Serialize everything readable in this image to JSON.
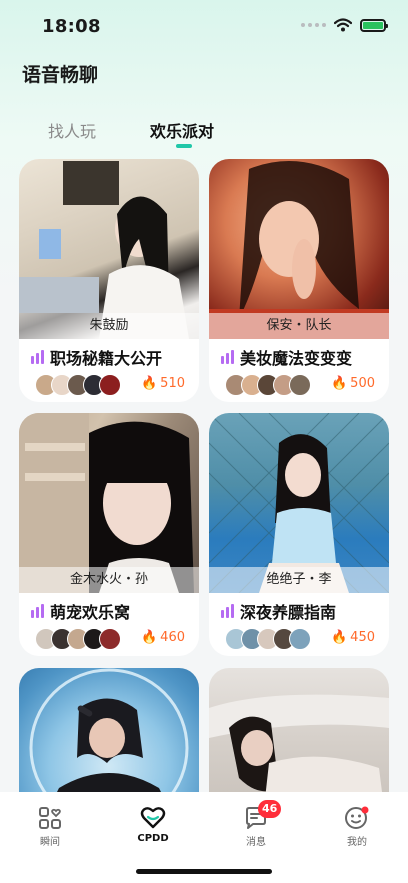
{
  "status_bar": {
    "time": "18:08"
  },
  "header": {
    "title": "语音畅聊"
  },
  "tabs": [
    {
      "label": "找人玩",
      "active": false
    },
    {
      "label": "欢乐派对",
      "active": true
    }
  ],
  "rooms": [
    {
      "host": "朱鼓励",
      "title": "职场秘籍大公开",
      "heat": "510"
    },
    {
      "host": "保安・队长",
      "title": "美妆魔法变变变",
      "heat": "500"
    },
    {
      "host": "金木水火・孙",
      "title": "萌宠欢乐窝",
      "heat": "460"
    },
    {
      "host": "绝绝子・李",
      "title": "深夜养膘指南",
      "heat": "450"
    }
  ],
  "bottom_nav": {
    "items": [
      {
        "label": "瞬间",
        "icon": "grid-heart-icon"
      },
      {
        "label": "CPDD",
        "icon": "heart-chat-icon"
      },
      {
        "label": "消息",
        "icon": "message-icon",
        "badge": "46"
      },
      {
        "label": "我的",
        "icon": "profile-icon"
      }
    ]
  },
  "colors": {
    "accent": "#20c7a8",
    "heat": "#ff6a2b",
    "badge": "#ff2d3a",
    "bars": "#b56bf2"
  }
}
